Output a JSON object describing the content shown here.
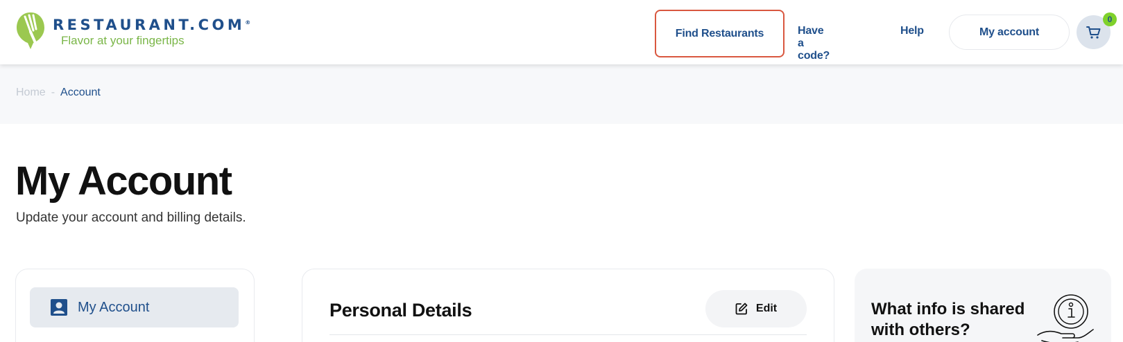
{
  "header": {
    "brand": "RESTAURANT.COM",
    "brand_mark": "®",
    "tagline": "Flavor at your fingertips",
    "nav": {
      "find_restaurants": "Find Restaurants",
      "have_a_code": "Have a code?",
      "help": "Help",
      "my_account": "My account"
    },
    "cart_count": "0",
    "cart_icon": "cart-icon",
    "colors": {
      "brand_blue": "#1f4f8b",
      "brand_green": "#7ab648",
      "badge_green": "#7fd12b",
      "highlight": "#d9573f"
    }
  },
  "breadcrumb": {
    "home": "Home",
    "separator": "-",
    "current": "Account"
  },
  "page": {
    "title": "My Account",
    "subtitle": "Update your account and billing details."
  },
  "sidebar": {
    "items": [
      {
        "label": "My Account",
        "icon": "user-id-icon"
      }
    ]
  },
  "personal_details": {
    "title": "Personal Details",
    "edit_label": "Edit",
    "edit_icon": "edit-icon"
  },
  "info_panel": {
    "title": "What info is shared with others?",
    "icon": "info-hand-icon"
  }
}
